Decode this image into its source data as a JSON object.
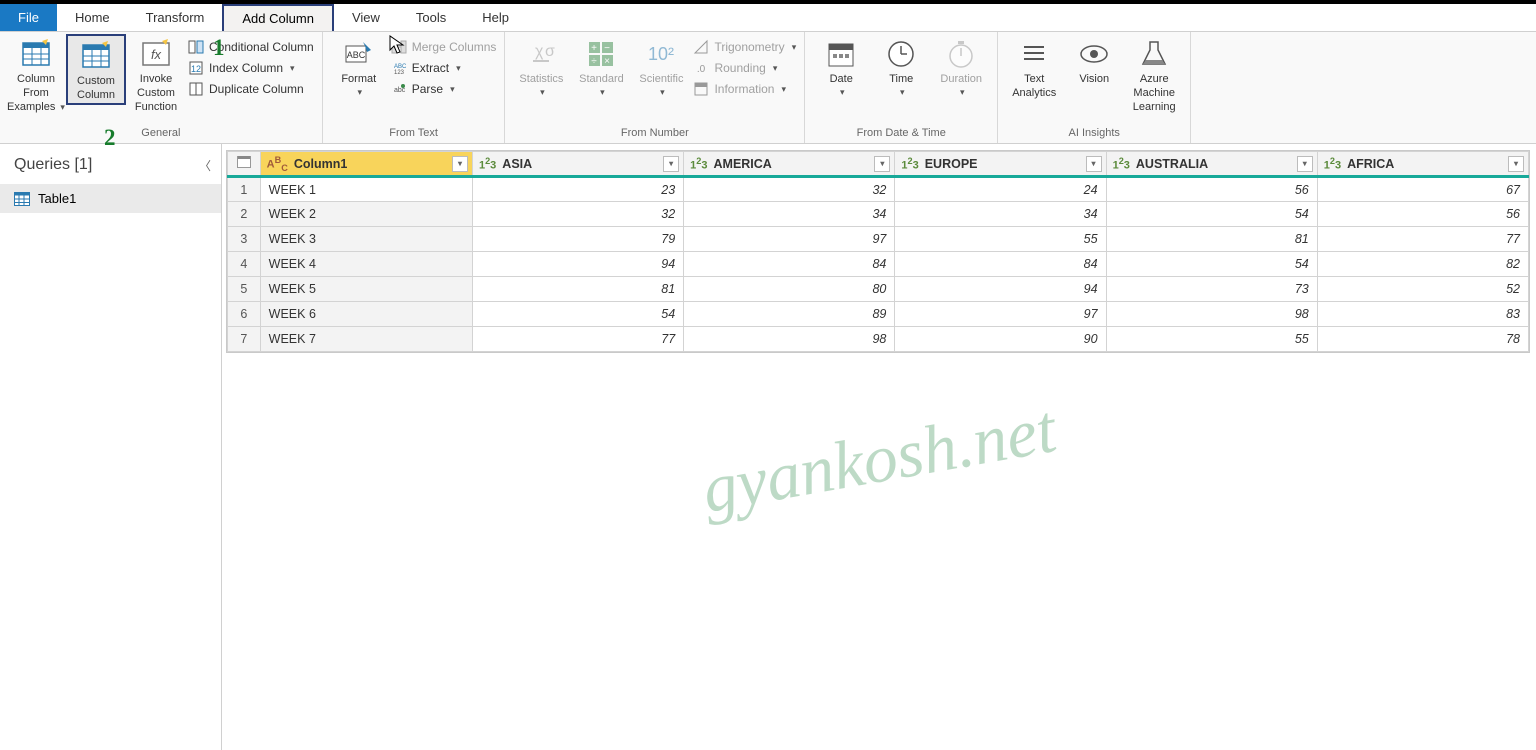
{
  "menu": {
    "file": "File",
    "items": [
      "Home",
      "Transform",
      "Add Column",
      "View",
      "Tools",
      "Help"
    ],
    "active_index": 2
  },
  "annotations": {
    "one": "1",
    "two": "2"
  },
  "watermark": "gyankosh.net",
  "ribbon": {
    "groups": [
      {
        "title": "General",
        "big": [
          {
            "label1": "Column From",
            "label2": "Examples",
            "caret": true,
            "name": "column-from-examples",
            "boxed": false
          },
          {
            "label1": "Custom",
            "label2": "Column",
            "caret": false,
            "name": "custom-column",
            "boxed": true
          },
          {
            "label1": "Invoke Custom",
            "label2": "Function",
            "caret": false,
            "name": "invoke-custom-function",
            "boxed": false
          }
        ],
        "small": [
          {
            "label": "Conditional Column",
            "caret": false,
            "name": "conditional-column"
          },
          {
            "label": "Index Column",
            "caret": true,
            "name": "index-column"
          },
          {
            "label": "Duplicate Column",
            "caret": false,
            "name": "duplicate-column"
          }
        ]
      },
      {
        "title": "From Text",
        "big": [
          {
            "label1": "Format",
            "label2": "",
            "caret": true,
            "name": "format-button",
            "boxed": false
          }
        ],
        "small": [
          {
            "label": "Merge Columns",
            "caret": false,
            "name": "merge-columns",
            "disabled": true
          },
          {
            "label": "Extract",
            "caret": true,
            "name": "extract"
          },
          {
            "label": "Parse",
            "caret": true,
            "name": "parse"
          }
        ]
      },
      {
        "title": "From Number",
        "big": [
          {
            "label1": "Statistics",
            "label2": "",
            "caret": true,
            "name": "statistics-button",
            "disabled": true
          },
          {
            "label1": "Standard",
            "label2": "",
            "caret": true,
            "name": "standard-button",
            "disabled": true
          },
          {
            "label1": "Scientific",
            "label2": "",
            "caret": true,
            "name": "scientific-button",
            "disabled": true
          }
        ],
        "small": [
          {
            "label": "Trigonometry",
            "caret": true,
            "name": "trigonometry",
            "disabled": true
          },
          {
            "label": "Rounding",
            "caret": true,
            "name": "rounding",
            "disabled": true
          },
          {
            "label": "Information",
            "caret": true,
            "name": "information",
            "disabled": true
          }
        ]
      },
      {
        "title": "From Date & Time",
        "big": [
          {
            "label1": "Date",
            "label2": "",
            "caret": true,
            "name": "date-button"
          },
          {
            "label1": "Time",
            "label2": "",
            "caret": true,
            "name": "time-button"
          },
          {
            "label1": "Duration",
            "label2": "",
            "caret": true,
            "name": "duration-button",
            "disabled": true
          }
        ]
      },
      {
        "title": "AI Insights",
        "big": [
          {
            "label1": "Text",
            "label2": "Analytics",
            "caret": false,
            "name": "text-analytics"
          },
          {
            "label1": "Vision",
            "label2": "",
            "caret": false,
            "name": "vision-button"
          },
          {
            "label1": "Azure Machine",
            "label2": "Learning",
            "caret": false,
            "name": "azure-ml"
          }
        ]
      }
    ]
  },
  "queries": {
    "heading": "Queries [1]",
    "items": [
      "Table1"
    ]
  },
  "table": {
    "columns": [
      {
        "name": "Column1",
        "type": "text",
        "first": true
      },
      {
        "name": "ASIA",
        "type": "number",
        "first": false
      },
      {
        "name": "AMERICA",
        "type": "number",
        "first": false
      },
      {
        "name": "EUROPE",
        "type": "number",
        "first": false
      },
      {
        "name": "AUSTRALIA",
        "type": "number",
        "first": false
      },
      {
        "name": "AFRICA",
        "type": "number",
        "first": false
      }
    ],
    "rows": [
      {
        "n": "1",
        "label": "WEEK 1",
        "v": [
          "23",
          "32",
          "24",
          "56",
          "67"
        ]
      },
      {
        "n": "2",
        "label": "WEEK 2",
        "v": [
          "32",
          "34",
          "34",
          "54",
          "56"
        ]
      },
      {
        "n": "3",
        "label": "WEEK 3",
        "v": [
          "79",
          "97",
          "55",
          "81",
          "77"
        ]
      },
      {
        "n": "4",
        "label": "WEEK 4",
        "v": [
          "94",
          "84",
          "84",
          "54",
          "82"
        ]
      },
      {
        "n": "5",
        "label": "WEEK 5",
        "v": [
          "81",
          "80",
          "94",
          "73",
          "52"
        ]
      },
      {
        "n": "6",
        "label": "WEEK 6",
        "v": [
          "54",
          "89",
          "97",
          "98",
          "83"
        ]
      },
      {
        "n": "7",
        "label": "WEEK 7",
        "v": [
          "77",
          "98",
          "90",
          "55",
          "78"
        ]
      }
    ]
  },
  "type_label": {
    "text": "ABC",
    "number": "1²3"
  }
}
